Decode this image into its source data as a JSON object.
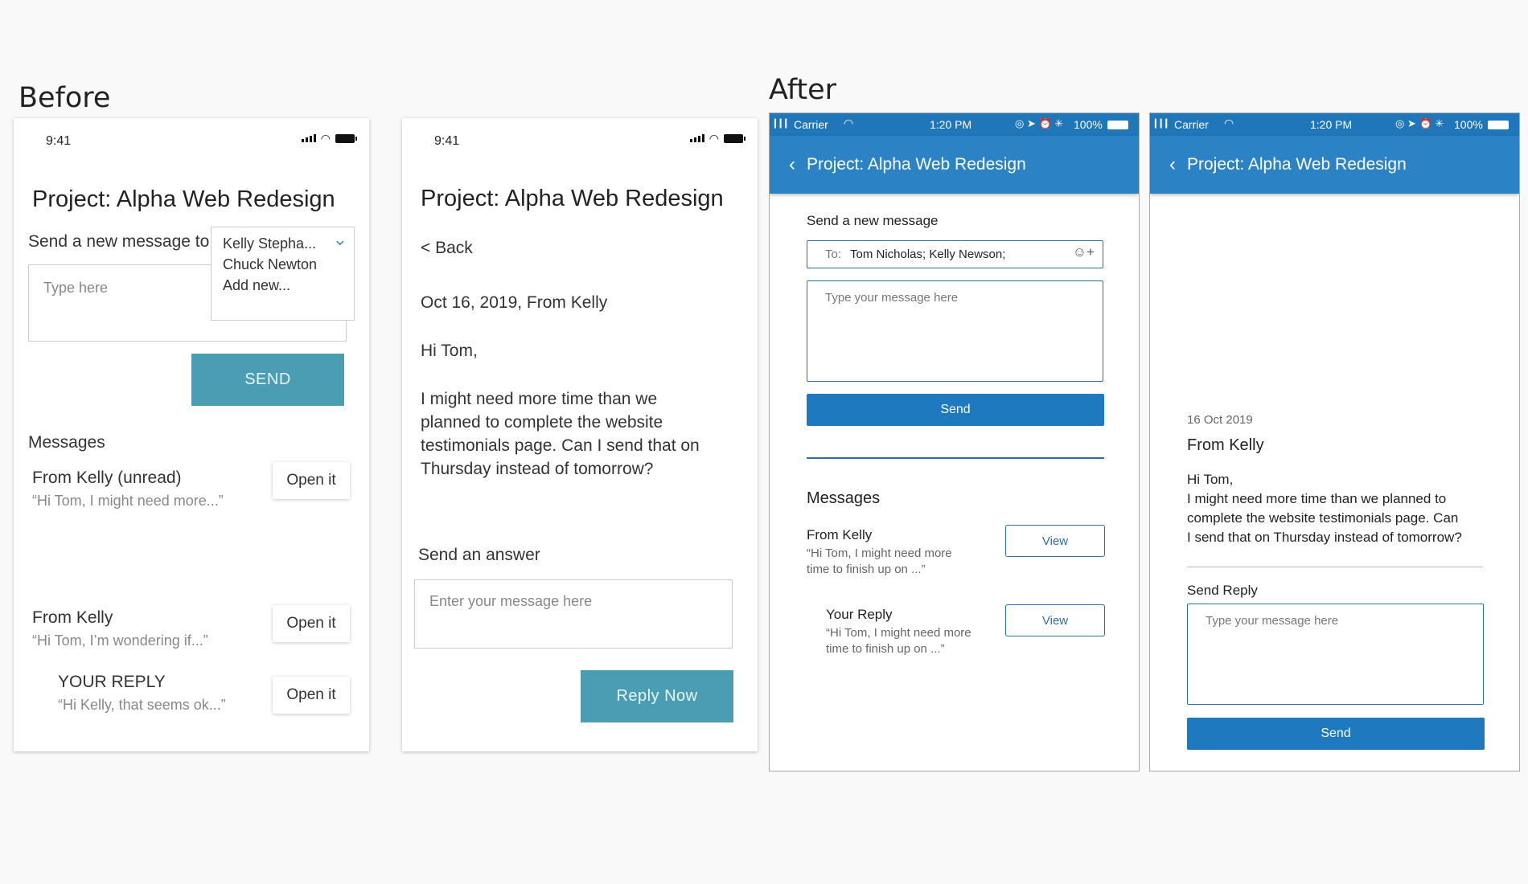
{
  "labels": {
    "before": "Before",
    "after": "After"
  },
  "before_list": {
    "time": "9:41",
    "title": "Project: Alpha Web Redesign",
    "send_label": "Send a new message to",
    "recipients": [
      "Kelly Stepha...",
      "Chuck Newton",
      "Add new..."
    ],
    "input_placeholder": "Type here",
    "send_button": "SEND",
    "messages_heading": "Messages",
    "messages": [
      {
        "from": "From Kelly (unread)",
        "preview": "“Hi Tom, I might need more...”",
        "button": "Open it"
      },
      {
        "from": "From Kelly",
        "preview": "“Hi Tom, I’m wondering if...”",
        "button": "Open it"
      },
      {
        "from": "YOUR REPLY",
        "preview": "“Hi Kelly, that seems ok...”",
        "button": "Open it"
      }
    ]
  },
  "before_detail": {
    "time": "9:41",
    "title": "Project: Alpha Web Redesign",
    "back": "< Back",
    "meta": "Oct 16, 2019, From Kelly",
    "greeting": "Hi Tom,",
    "body_lines": [
      "I might need more time than we",
      "planned to complete the website",
      "testimonials page. Can I send that on",
      "Thursday instead of tomorrow?"
    ],
    "answer_label": "Send an answer",
    "answer_placeholder": "Enter your message here",
    "reply_button": "Reply Now"
  },
  "ios_status": {
    "carrier": "Carrier",
    "time": "1:20 PM",
    "battery": "100%"
  },
  "after_list": {
    "nav_title": "Project: Alpha Web Redesign",
    "send_heading": "Send a new message",
    "to_label": "To:",
    "to_value": "Tom Nicholas; Kelly Newson;",
    "message_placeholder": "Type your message here",
    "send_button": "Send",
    "messages_heading": "Messages",
    "messages": [
      {
        "from": "From Kelly",
        "preview_lines": [
          "“Hi Tom, I might need more",
          "time to finish up on ...”"
        ],
        "button": "View"
      },
      {
        "from": "Your Reply",
        "preview_lines": [
          "“Hi Tom, I might need more",
          "time to finish up on ...”"
        ],
        "button": "View"
      }
    ]
  },
  "after_detail": {
    "nav_title": "Project: Alpha Web Redesign",
    "date": "16 Oct 2019",
    "from": "From Kelly",
    "body_lines": [
      "Hi Tom,",
      "I might need more time than we planned to",
      "complete the website testimonials page. Can",
      "I send that on Thursday instead of tomorrow?"
    ],
    "reply_label": "Send Reply",
    "reply_placeholder": "Type your message here",
    "send_button": "Send"
  },
  "colors": {
    "teal": "#4a9db3",
    "ios_blue": "#2b82c4",
    "button_blue": "#1f79be"
  }
}
